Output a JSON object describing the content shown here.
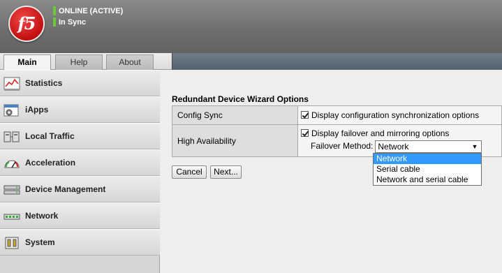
{
  "header": {
    "logo_text": "f5",
    "status_primary": "ONLINE (ACTIVE)",
    "status_secondary": "In Sync",
    "status_color": "#6cc83a"
  },
  "tabs": [
    {
      "label": "Main",
      "active": true
    },
    {
      "label": "Help",
      "active": false
    },
    {
      "label": "About",
      "active": false
    }
  ],
  "sidebar": {
    "items": [
      {
        "label": "Statistics",
        "icon": "chart-icon"
      },
      {
        "label": "iApps",
        "icon": "window-gear-icon"
      },
      {
        "label": "Local Traffic",
        "icon": "servers-icon"
      },
      {
        "label": "Acceleration",
        "icon": "gauge-icon"
      },
      {
        "label": "Device Management",
        "icon": "device-icon"
      },
      {
        "label": "Network",
        "icon": "network-icon"
      },
      {
        "label": "System",
        "icon": "system-icon"
      }
    ]
  },
  "main": {
    "section_title": "Redundant Device Wizard Options",
    "rows": [
      {
        "label": "Config Sync",
        "checkbox_label": "Display configuration synchronization options",
        "checked": true
      },
      {
        "label": "High Availability",
        "checkbox_label": "Display failover and mirroring options",
        "checked": true
      }
    ],
    "failover_label": "Failover Method:",
    "failover_value": "Network",
    "failover_options": [
      "Network",
      "Serial cable",
      "Network and serial cable"
    ],
    "buttons": {
      "cancel": "Cancel",
      "next": "Next..."
    }
  }
}
